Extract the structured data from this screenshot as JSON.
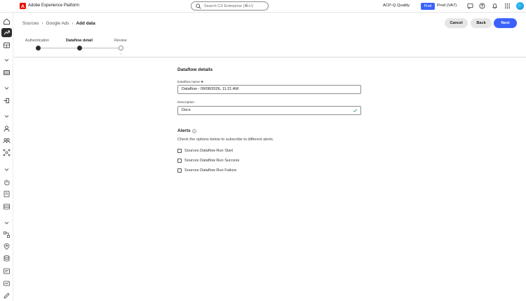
{
  "topbar": {
    "app_title": "Adobe Experience Platform",
    "search_placeholder": "Search CX Enterprise (⌘+/)",
    "org_name": "ACP-Q Quality",
    "env_badge": "Prod",
    "sandbox_name": "Prod (VA7)"
  },
  "breadcrumb": {
    "items": [
      "Sources",
      "Google Ads"
    ],
    "current": "Add data"
  },
  "actions": {
    "cancel": "Cancel",
    "back": "Back",
    "next": "Next"
  },
  "steps": [
    {
      "label": "Authentication",
      "state": "complete"
    },
    {
      "label": "Dataflow detail",
      "state": "current"
    },
    {
      "label": "Review",
      "state": "pending"
    }
  ],
  "form": {
    "section_title": "Dataflow details",
    "name_label": "Dataflow name",
    "name_value": "Dataflow - 09/08/2026, 11:21 AM",
    "description_label": "Description",
    "description_value": "Docs"
  },
  "alerts": {
    "title": "Alerts",
    "description": "Check the options below to subscribe to different alerts.",
    "options": [
      {
        "label": "Sources Dataflow Run Start",
        "checked": false
      },
      {
        "label": "Sources Dataflow Run Success",
        "checked": false
      },
      {
        "label": "Sources Dataflow Run Failure",
        "checked": false
      }
    ]
  },
  "colors": {
    "accent": "#3b63fb",
    "brand": "#eb1000"
  }
}
